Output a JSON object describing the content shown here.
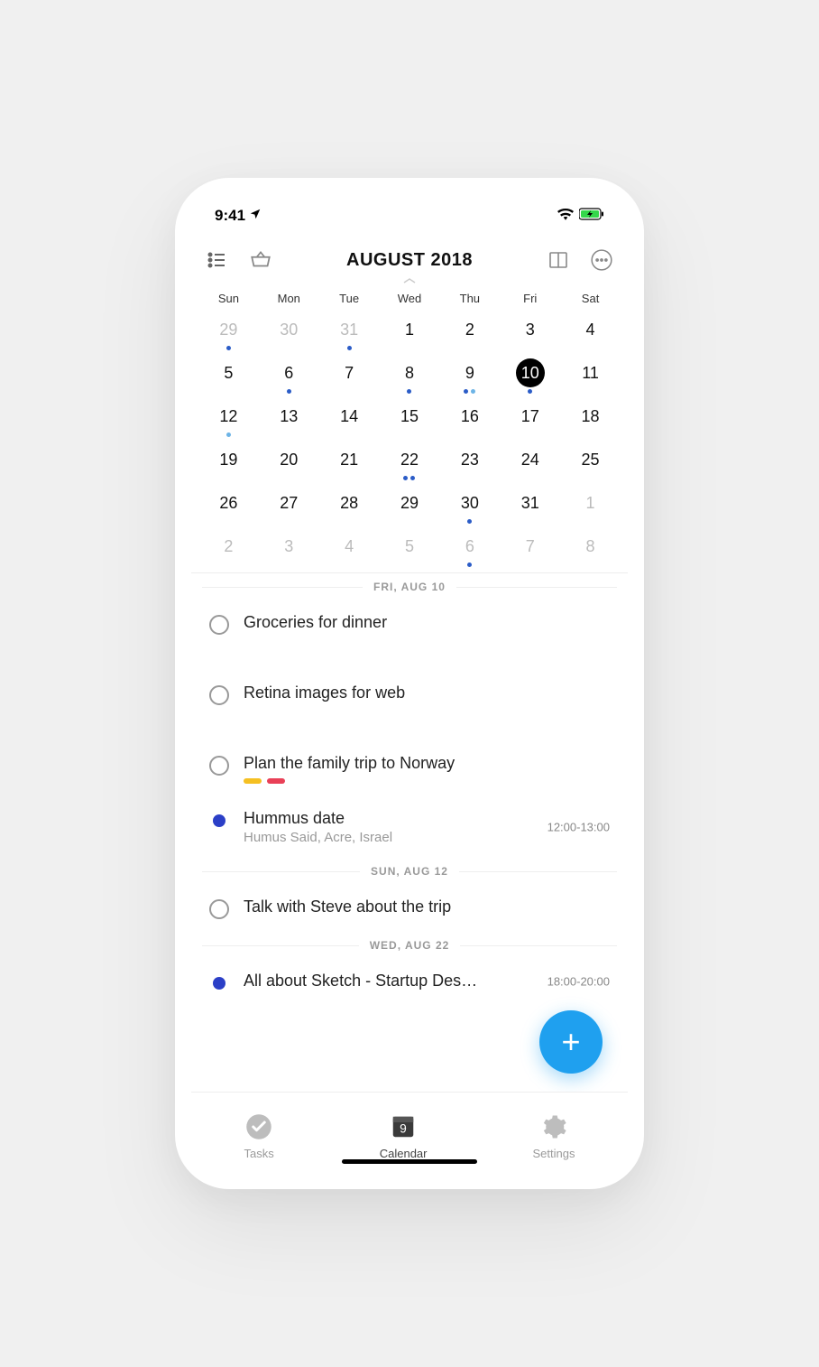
{
  "statusBar": {
    "time": "9:41"
  },
  "header": {
    "monthTitle": "AUGUST 2018"
  },
  "weekdays": [
    "Sun",
    "Mon",
    "Tue",
    "Wed",
    "Thu",
    "Fri",
    "Sat"
  ],
  "calendar": [
    {
      "n": "29",
      "other": true,
      "dots": [
        "dark"
      ]
    },
    {
      "n": "30",
      "other": true
    },
    {
      "n": "31",
      "other": true,
      "dots": [
        "dark"
      ]
    },
    {
      "n": "1"
    },
    {
      "n": "2"
    },
    {
      "n": "3"
    },
    {
      "n": "4"
    },
    {
      "n": "5"
    },
    {
      "n": "6",
      "dots": [
        "dark"
      ]
    },
    {
      "n": "7"
    },
    {
      "n": "8",
      "dots": [
        "dark"
      ]
    },
    {
      "n": "9",
      "dots": [
        "dark",
        "light"
      ]
    },
    {
      "n": "10",
      "selected": true,
      "dots": [
        "dark"
      ]
    },
    {
      "n": "11"
    },
    {
      "n": "12",
      "dots": [
        "light"
      ]
    },
    {
      "n": "13"
    },
    {
      "n": "14"
    },
    {
      "n": "15"
    },
    {
      "n": "16"
    },
    {
      "n": "17"
    },
    {
      "n": "18"
    },
    {
      "n": "19"
    },
    {
      "n": "20"
    },
    {
      "n": "21"
    },
    {
      "n": "22",
      "dots": [
        "dark",
        "dark"
      ]
    },
    {
      "n": "23"
    },
    {
      "n": "24"
    },
    {
      "n": "25"
    },
    {
      "n": "26"
    },
    {
      "n": "27"
    },
    {
      "n": "28"
    },
    {
      "n": "29"
    },
    {
      "n": "30",
      "dots": [
        "dark"
      ]
    },
    {
      "n": "31"
    },
    {
      "n": "1",
      "other": true
    },
    {
      "n": "2",
      "other": true
    },
    {
      "n": "3",
      "other": true
    },
    {
      "n": "4",
      "other": true
    },
    {
      "n": "5",
      "other": true
    },
    {
      "n": "6",
      "other": true,
      "dots": [
        "dark"
      ]
    },
    {
      "n": "7",
      "other": true
    },
    {
      "n": "8",
      "other": true
    }
  ],
  "agenda": [
    {
      "type": "section",
      "label": "FRI, AUG 10"
    },
    {
      "type": "task",
      "title": "Groceries for dinner"
    },
    {
      "type": "task",
      "title": "Retina images for web"
    },
    {
      "type": "task",
      "title": "Plan the family trip to Norway",
      "tags": [
        "#f5c022",
        "#e94057"
      ]
    },
    {
      "type": "event",
      "title": "Hummus date",
      "sub": "Humus Said, Acre, Israel",
      "time": "12:00-13:00"
    },
    {
      "type": "section",
      "label": "SUN, AUG 12"
    },
    {
      "type": "task",
      "title": "Talk with Steve about the trip"
    },
    {
      "type": "section",
      "label": "WED, AUG 22"
    },
    {
      "type": "event",
      "title": "All about Sketch - Startup Des…",
      "time": "18:00-20:00"
    }
  ],
  "tabs": {
    "tasks": "Tasks",
    "calendar": "Calendar",
    "calendarDay": "9",
    "settings": "Settings"
  }
}
